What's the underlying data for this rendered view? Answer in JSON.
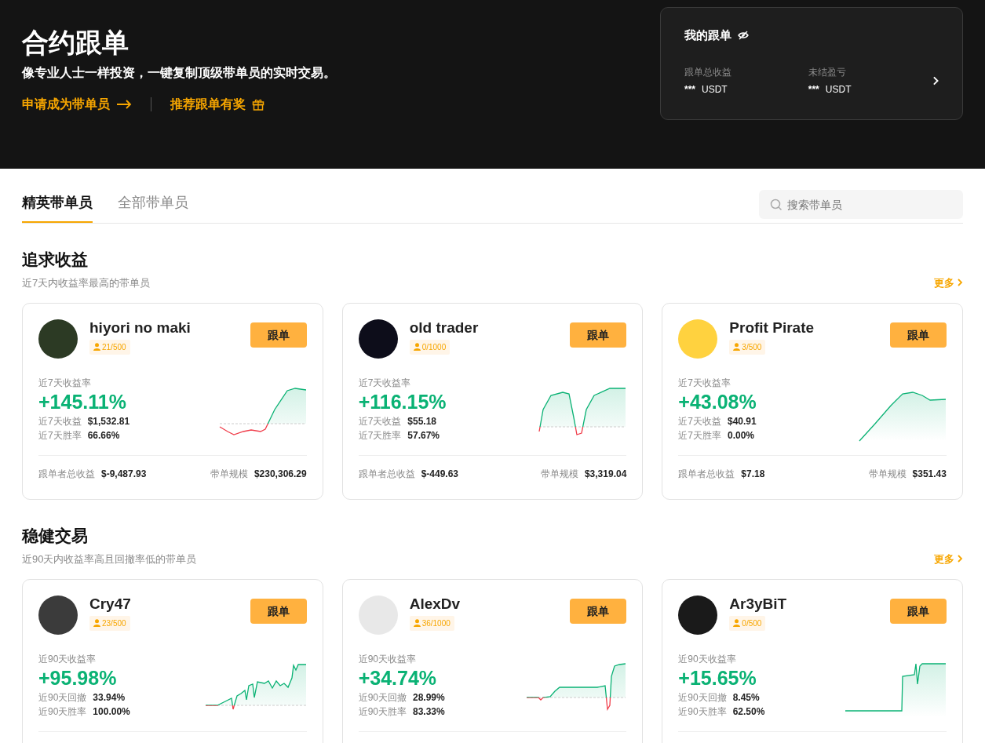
{
  "header": {
    "title": "合约跟单",
    "subtitle": "像专业人士一样投资，一键复制顶级带单员的实时交易。",
    "links": [
      {
        "label": "申请成为带单员",
        "kind": "arrow"
      },
      {
        "label": "推荐跟单有奖",
        "kind": "gift"
      }
    ]
  },
  "my_copy": {
    "title": "我的跟单",
    "stats": [
      {
        "label": "跟单总收益",
        "value": "***",
        "unit": "USDT"
      },
      {
        "label": "未结盈亏",
        "value": "***",
        "unit": "USDT"
      }
    ]
  },
  "tabs": [
    {
      "label": "精英带单员",
      "selected": true
    },
    {
      "label": "全部带单员",
      "selected": false
    }
  ],
  "search": {
    "placeholder": "搜索带单员"
  },
  "sections": [
    {
      "title": "追求收益",
      "subtitle": "近7天内收益率最高的带单员",
      "more": "更多",
      "traders": [
        {
          "name": "hiyori no maki",
          "followers": "21/500",
          "button": "跟单",
          "roi_label": "近7天收益率",
          "roi": "+145.11%",
          "stats": [
            {
              "label": "近7天收益",
              "value": "$1,532.81"
            },
            {
              "label": "近7天胜率",
              "value": "66.66%"
            }
          ],
          "footer": [
            {
              "label": "跟单者总收益",
              "value": "$-9,487.93"
            },
            {
              "label": "带单规模",
              "value": "$230,306.29"
            }
          ]
        },
        {
          "name": "old trader",
          "followers": "0/1000",
          "button": "跟单",
          "roi_label": "近7天收益率",
          "roi": "+116.15%",
          "stats": [
            {
              "label": "近7天收益",
              "value": "$55.18"
            },
            {
              "label": "近7天胜率",
              "value": "57.67%"
            }
          ],
          "footer": [
            {
              "label": "跟单者总收益",
              "value": "$-449.63"
            },
            {
              "label": "带单规模",
              "value": "$3,319.04"
            }
          ]
        },
        {
          "name": "Profit Pirate",
          "followers": "3/500",
          "button": "跟单",
          "roi_label": "近7天收益率",
          "roi": "+43.08%",
          "stats": [
            {
              "label": "近7天收益",
              "value": "$40.91"
            },
            {
              "label": "近7天胜率",
              "value": "0.00%"
            }
          ],
          "footer": [
            {
              "label": "跟单者总收益",
              "value": "$7.18"
            },
            {
              "label": "带单规模",
              "value": "$351.43"
            }
          ]
        }
      ]
    },
    {
      "title": "稳健交易",
      "subtitle": "近90天内收益率高且回撤率低的带单员",
      "more": "更多",
      "traders": [
        {
          "name": "Cry47",
          "followers": "23/500",
          "button": "跟单",
          "roi_label": "近90天收益率",
          "roi": "+95.98%",
          "stats": [
            {
              "label": "近90天回撤",
              "value": "33.94%"
            },
            {
              "label": "近90天胜率",
              "value": "100.00%"
            }
          ]
        },
        {
          "name": "AlexDv",
          "followers": "36/1000",
          "button": "跟单",
          "roi_label": "近90天收益率",
          "roi": "+34.74%",
          "stats": [
            {
              "label": "近90天回撤",
              "value": "28.99%"
            },
            {
              "label": "近90天胜率",
              "value": "83.33%"
            }
          ]
        },
        {
          "name": "Ar3yBiT",
          "followers": "0/500",
          "button": "跟单",
          "roi_label": "近90天收益率",
          "roi": "+15.65%",
          "stats": [
            {
              "label": "近90天回撤",
              "value": "8.45%"
            },
            {
              "label": "近90天胜率",
              "value": "62.50%"
            }
          ]
        }
      ]
    }
  ]
}
